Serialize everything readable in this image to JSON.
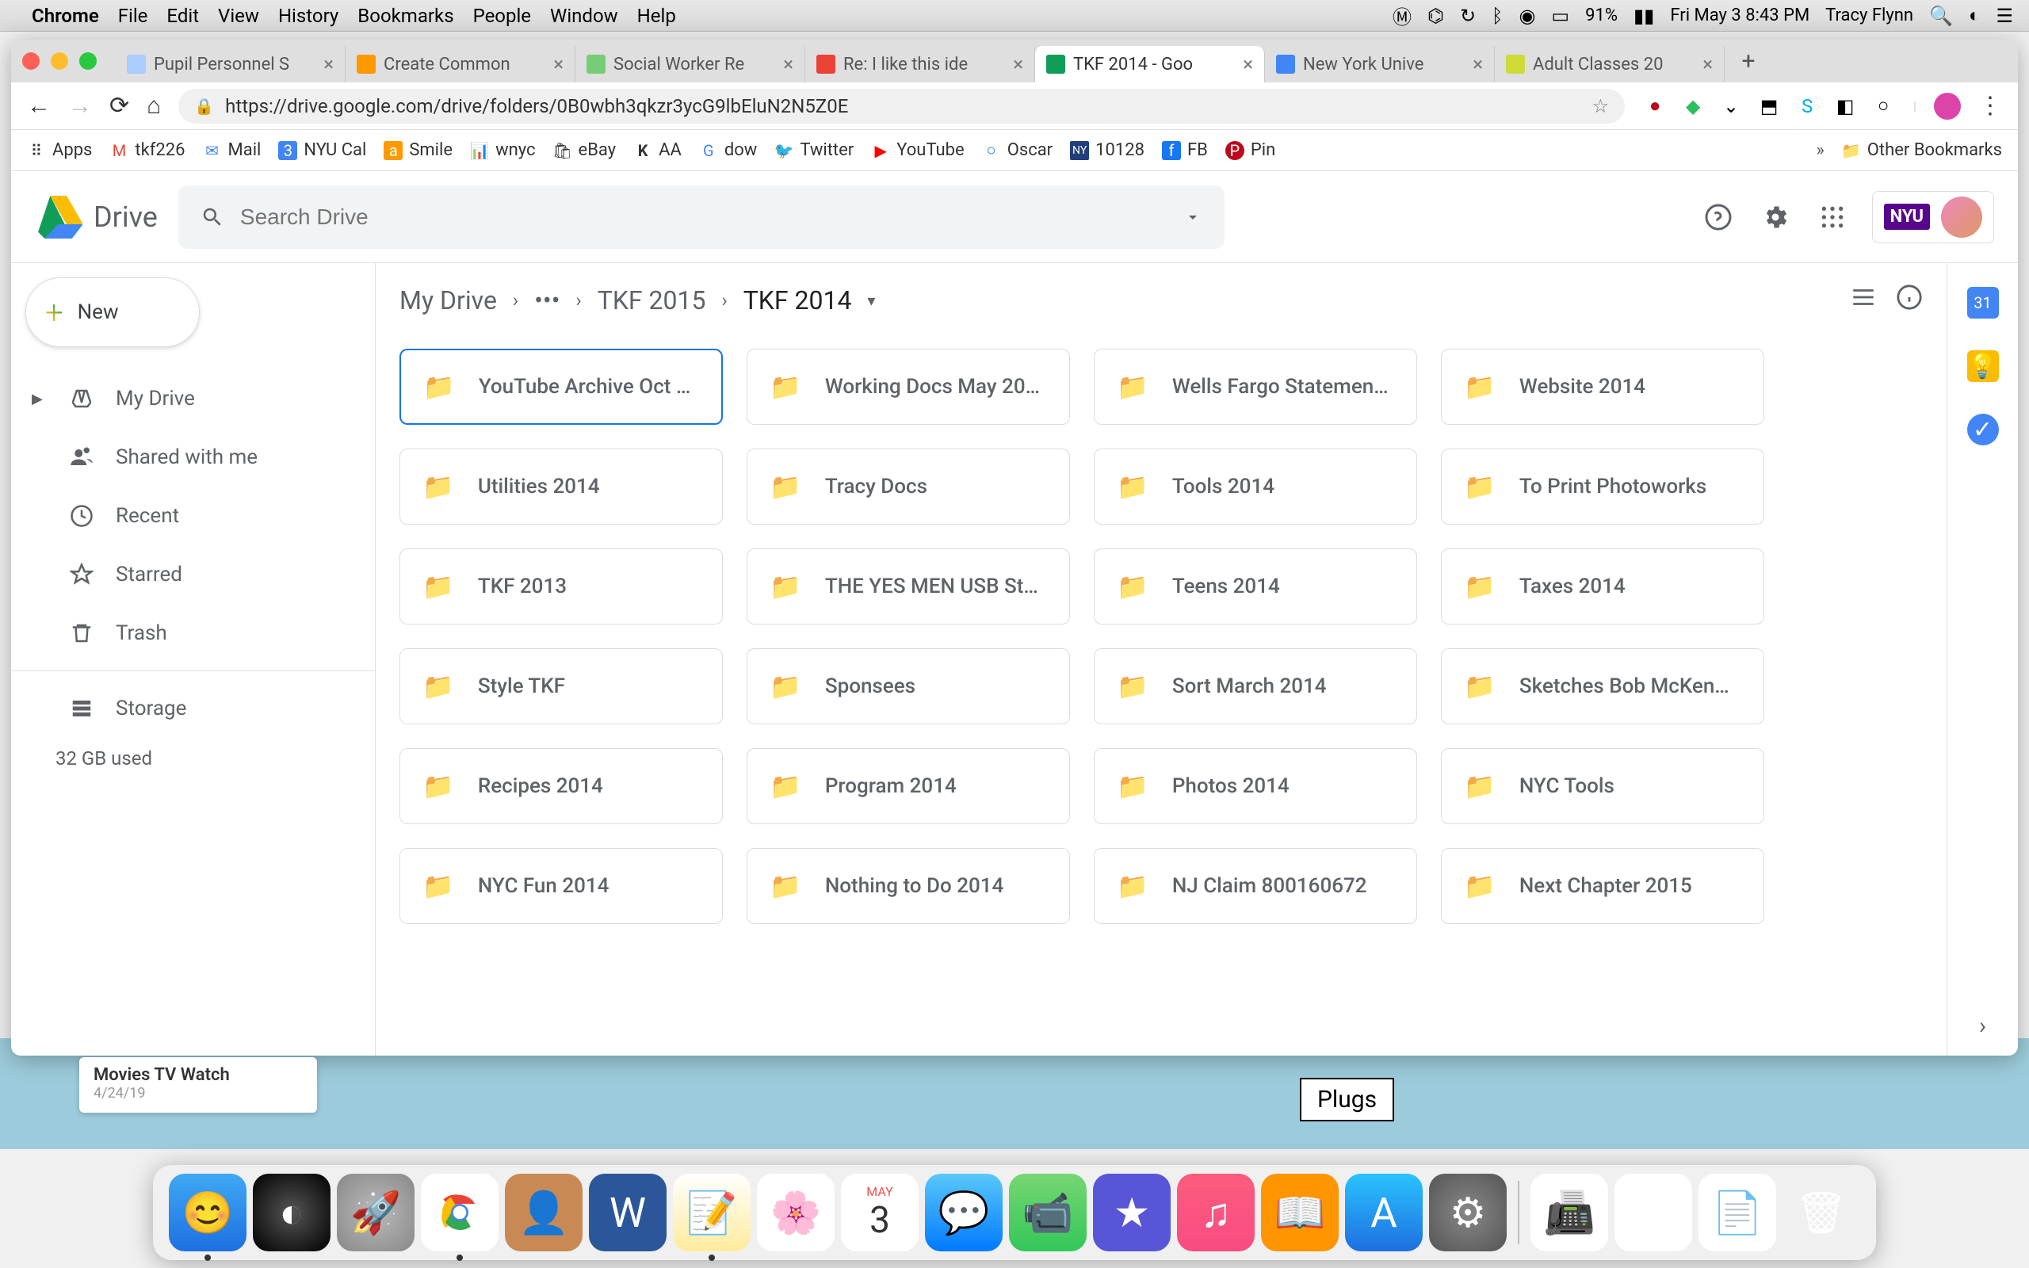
{
  "menubar": {
    "app": "Chrome",
    "menus": [
      "File",
      "Edit",
      "View",
      "History",
      "Bookmarks",
      "People",
      "Window",
      "Help"
    ],
    "battery": "91%",
    "datetime": "Fri May 3  8:43 PM",
    "user": "Tracy Flynn"
  },
  "browser": {
    "tabs": [
      {
        "title": "Pupil Personnel S",
        "fav": "#aaccff"
      },
      {
        "title": "Create Common",
        "fav": "#ff9900"
      },
      {
        "title": "Social Worker Re",
        "fav": "#77cc77"
      },
      {
        "title": "Re: I like this ide",
        "fav": "#ea4335"
      },
      {
        "title": "TKF 2014 - Goo",
        "fav": "#0f9d58",
        "active": true
      },
      {
        "title": "New York Unive",
        "fav": "#4285f4"
      },
      {
        "title": "Adult Classes 20",
        "fav": "#cddc39"
      }
    ],
    "url": "https://drive.google.com/drive/folders/0B0wbh3qkzr3ycG9lbEluN2N5Z0E",
    "bookmarks": [
      {
        "label": "Apps",
        "icon": "⠿"
      },
      {
        "label": "tkf226",
        "icon": "M"
      },
      {
        "label": "Mail",
        "icon": "✉"
      },
      {
        "label": "NYU Cal",
        "icon": "📅"
      },
      {
        "label": "Smile",
        "icon": "a"
      },
      {
        "label": "wnyc",
        "icon": "📊"
      },
      {
        "label": "eBay",
        "icon": "🛍"
      },
      {
        "label": "AA",
        "icon": "K"
      },
      {
        "label": "dow",
        "icon": "G"
      },
      {
        "label": "Twitter",
        "icon": "🐦"
      },
      {
        "label": "YouTube",
        "icon": "▶"
      },
      {
        "label": "Oscar",
        "icon": "○"
      },
      {
        "label": "10128",
        "icon": "📰"
      },
      {
        "label": "FB",
        "icon": "f"
      },
      {
        "label": "Pin",
        "icon": "P"
      }
    ],
    "other_bookmarks": "Other Bookmarks"
  },
  "drive": {
    "product": "Drive",
    "search_placeholder": "Search Drive",
    "account_org": "NYU",
    "new_label": "New",
    "nav": [
      {
        "label": "My Drive",
        "icon": "drive"
      },
      {
        "label": "Shared with me",
        "icon": "people"
      },
      {
        "label": "Recent",
        "icon": "clock"
      },
      {
        "label": "Starred",
        "icon": "star"
      },
      {
        "label": "Trash",
        "icon": "trash"
      }
    ],
    "storage_label": "Storage",
    "storage_used": "32 GB used",
    "breadcrumb": [
      "My Drive",
      "…",
      "TKF 2015",
      "TKF 2014"
    ],
    "folders": [
      "YouTube Archive Oct …",
      "Working Docs May 20…",
      "Wells Fargo Statemen…",
      "Website 2014",
      "Utilities 2014",
      "Tracy Docs",
      "Tools 2014",
      "To Print Photoworks",
      "TKF 2013",
      "THE YES MEN USB St…",
      "Teens 2014",
      "Taxes 2014",
      "Style TKF",
      "Sponsees",
      "Sort March 2014",
      "Sketches Bob McKen…",
      "Recipes 2014",
      "Program 2014",
      "Photos 2014",
      "NYC Tools",
      "NYC Fun 2014",
      "Nothing to Do 2014",
      "NJ Claim 800160672",
      "Next Chapter 2015"
    ]
  },
  "desktop": {
    "note_title": "Movies TV Watch",
    "note_date": "4/24/19",
    "plugs": "Plugs",
    "calendar_month": "MAY",
    "calendar_day": "3"
  }
}
